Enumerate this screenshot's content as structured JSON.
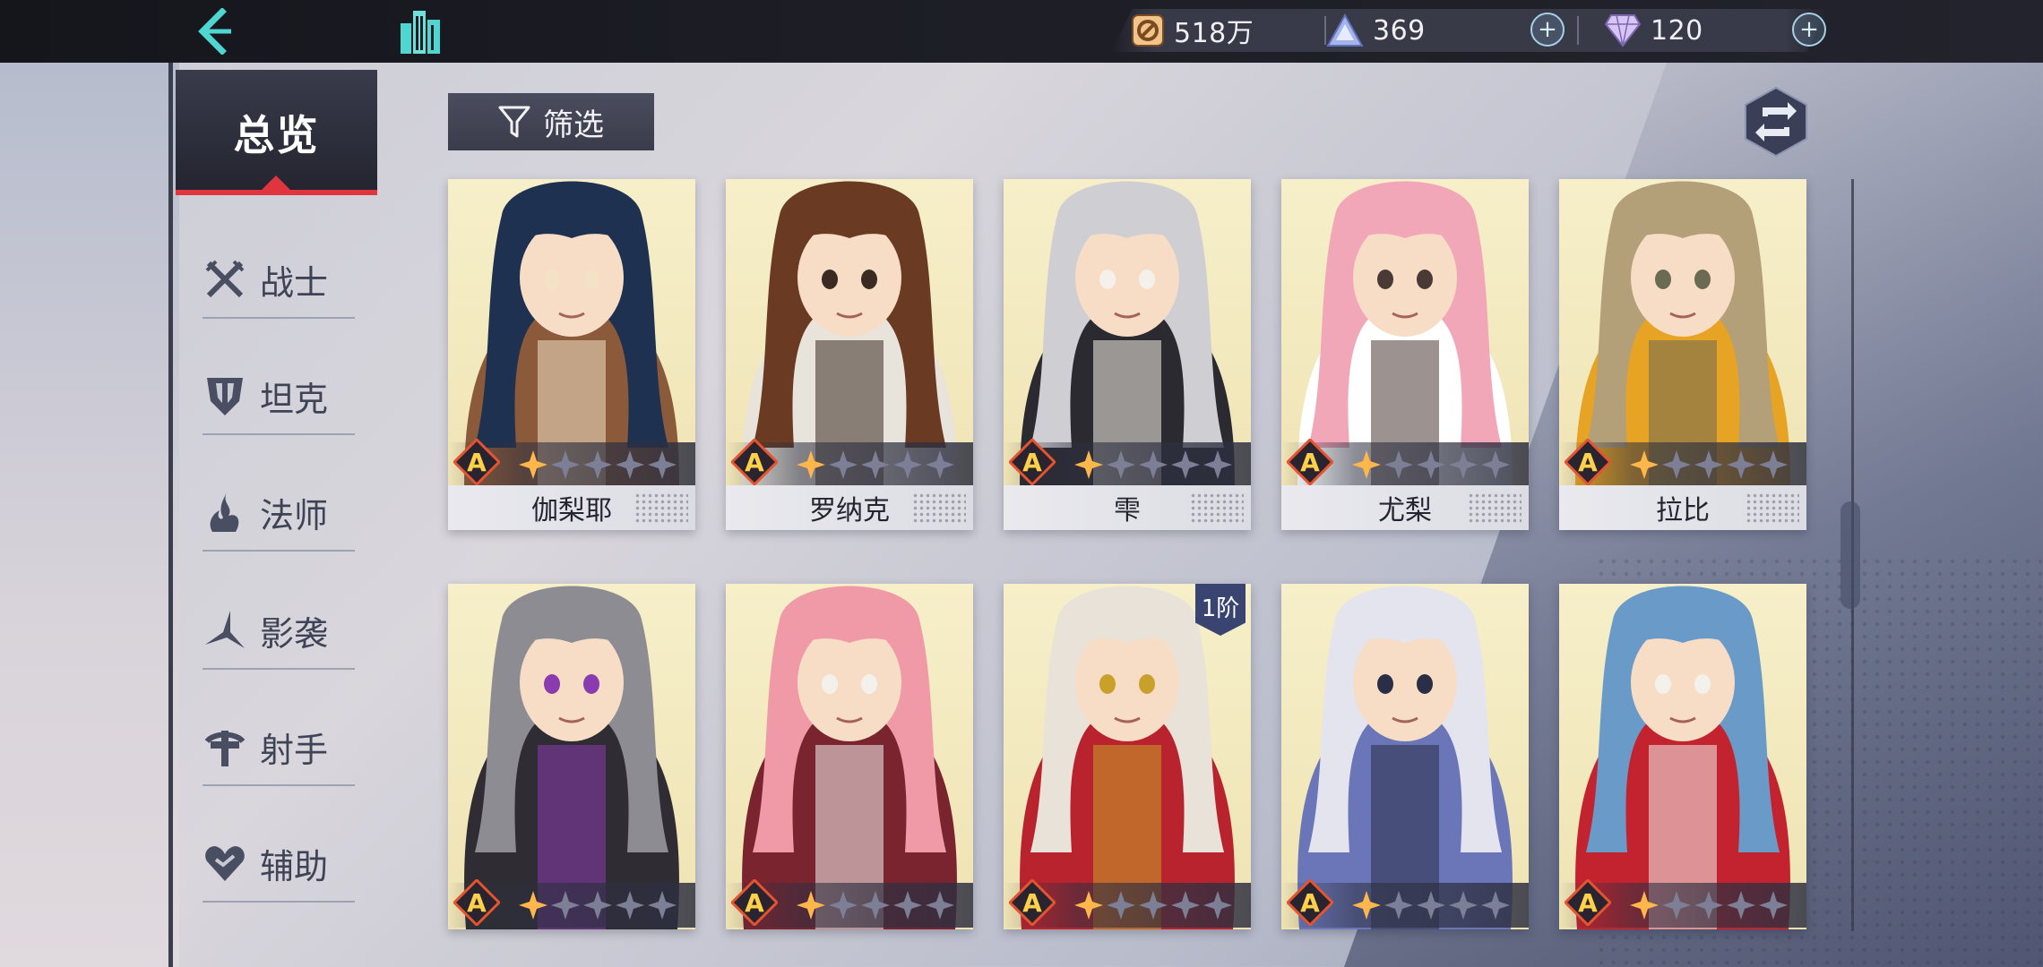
{
  "topbar": {
    "back_icon": "back-arrow-icon",
    "home_icon": "city-icon",
    "resources": [
      {
        "name": "gold",
        "icon": "gold-coin-icon",
        "value": "518万"
      },
      {
        "name": "energy",
        "icon": "crystal-triangle-icon",
        "value": "369"
      },
      {
        "name": "diamond",
        "icon": "diamond-icon",
        "value": "120"
      }
    ]
  },
  "sidebar": {
    "overview_label": "总览",
    "classes": [
      {
        "label": "战士",
        "icon": "crossed-swords-icon"
      },
      {
        "label": "坦克",
        "icon": "shield-icon"
      },
      {
        "label": "法师",
        "icon": "mage-icon"
      },
      {
        "label": "影袭",
        "icon": "shadow-blade-icon"
      },
      {
        "label": "射手",
        "icon": "crossbow-icon"
      },
      {
        "label": "辅助",
        "icon": "heart-icon"
      }
    ]
  },
  "toolbar": {
    "filter_label": "筛选",
    "filter_icon": "funnel-icon",
    "sort_icon": "cycle-arrows-icon"
  },
  "cards": [
    {
      "name": "伽梨耶",
      "rank": "A",
      "stars": 1,
      "max_stars": 5,
      "palette": [
        "#1f3150",
        "#8a5a3a",
        "#f3e2c5"
      ]
    },
    {
      "name": "罗纳克",
      "rank": "A",
      "stars": 1,
      "max_stars": 5,
      "palette": [
        "#6a3a22",
        "#e8e4dc",
        "#3a2a22"
      ]
    },
    {
      "name": "雫",
      "rank": "A",
      "stars": 1,
      "max_stars": 5,
      "palette": [
        "#cfcfd3",
        "#2a2a30",
        "#f5f1ea"
      ]
    },
    {
      "name": "尤梨",
      "rank": "A",
      "stars": 1,
      "max_stars": 5,
      "palette": [
        "#f1a7b8",
        "#ffffff",
        "#4a3a36"
      ]
    },
    {
      "name": "拉比",
      "rank": "A",
      "stars": 1,
      "max_stars": 5,
      "palette": [
        "#b4a078",
        "#e6a324",
        "#6b6a52"
      ]
    },
    {
      "name": "",
      "rank": "A",
      "stars": 1,
      "max_stars": 5,
      "palette": [
        "#8c8c92",
        "#2f2d33",
        "#8a3bb0"
      ]
    },
    {
      "name": "",
      "rank": "A",
      "stars": 1,
      "max_stars": 5,
      "palette": [
        "#f09aa8",
        "#7a2430",
        "#f4f1ec"
      ]
    },
    {
      "name": "",
      "rank": "A",
      "stars": 1,
      "max_stars": 5,
      "tier": "1阶",
      "palette": [
        "#e9e2d8",
        "#b8232e",
        "#c9a12a"
      ]
    },
    {
      "name": "",
      "rank": "A",
      "stars": 1,
      "max_stars": 5,
      "palette": [
        "#e4e4ee",
        "#6a76b8",
        "#2a2e46"
      ]
    },
    {
      "name": "",
      "rank": "A",
      "stars": 1,
      "max_stars": 5,
      "palette": [
        "#6a9ac8",
        "#c2232e",
        "#f4f1ec"
      ]
    }
  ]
}
